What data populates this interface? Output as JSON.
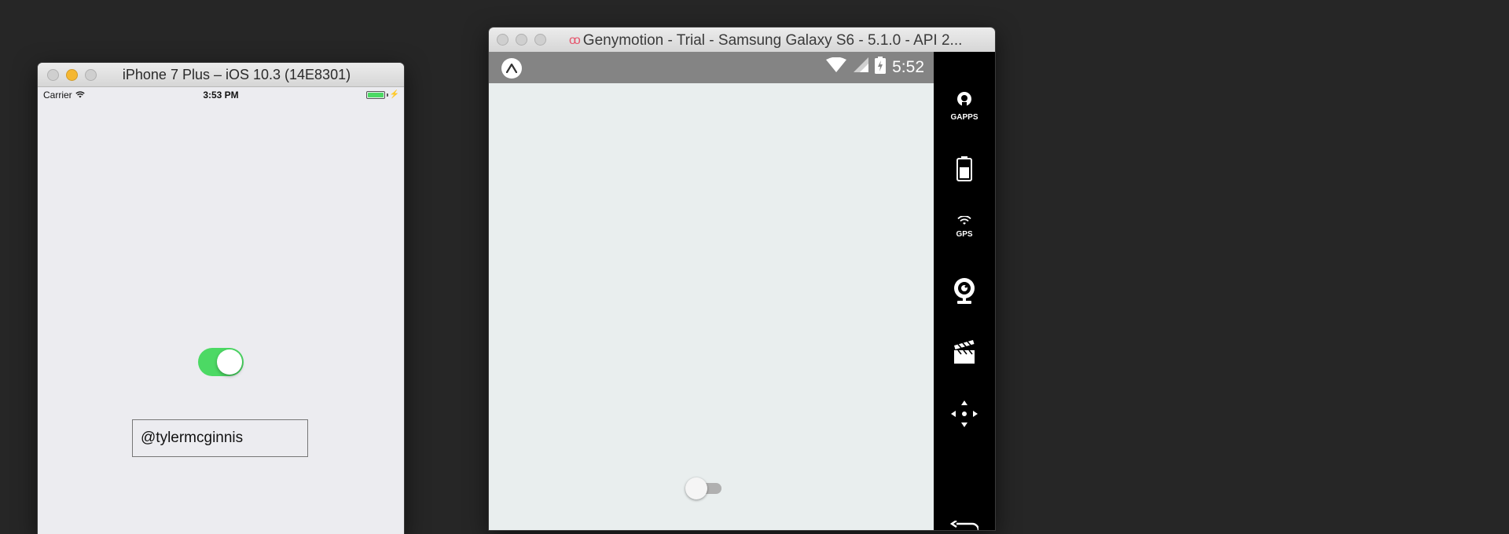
{
  "ios": {
    "window_title": "iPhone 7 Plus – iOS 10.3 (14E8301)",
    "carrier": "Carrier",
    "time": "3:53 PM",
    "switch_on": true,
    "text_input_value": "@tylermcginnis"
  },
  "genymotion": {
    "window_title": "Genymotion - Trial - Samsung Galaxy S6 - 5.1.0 - API 2...",
    "status_time": "5:52",
    "switch_on": false,
    "sidebar": {
      "gapps_label": "GAPPS",
      "gps_label": "GPS"
    }
  },
  "colors": {
    "ios_switch_on": "#4cd964",
    "android_status_bar": "#848484",
    "genymotion_logo": "#e5536b"
  },
  "icons": [
    "wifi-icon",
    "battery-icon",
    "bolt-icon",
    "expo-icon",
    "gapps-icon",
    "gps-icon",
    "camera-icon",
    "media-icon",
    "dpad-icon",
    "back-icon"
  ]
}
